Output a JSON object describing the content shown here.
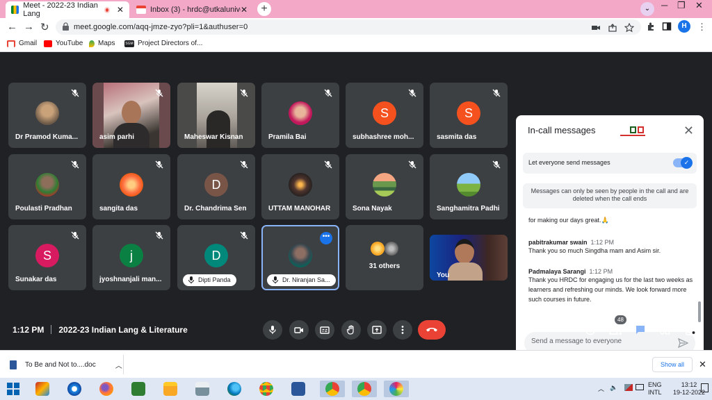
{
  "browser": {
    "tabs": [
      {
        "title": "Meet - 2022-23 Indian Lang",
        "active": true
      },
      {
        "title": "Inbox (3) - hrdc@utkaluniversity",
        "active": false
      }
    ],
    "new_tab": "+",
    "url": "meet.google.com/aqq-jmze-zyo?pli=1&authuser=0",
    "profile_initial": "H",
    "bookmarks": [
      "Gmail",
      "YouTube",
      "Maps",
      "Project Directors of..."
    ],
    "bookmark_ids": {
      "sgm": "SGM"
    }
  },
  "meet": {
    "tiles": [
      {
        "name": "Dr Pramod Kuma..."
      },
      {
        "name": "asim parhi"
      },
      {
        "name": "Maheswar Kisnan"
      },
      {
        "name": "Pramila Bai"
      },
      {
        "name": "subhashree moh...",
        "initial": "S"
      },
      {
        "name": "sasmita das",
        "initial": "S"
      },
      {
        "name": "Poulasti Pradhan"
      },
      {
        "name": "sangita das"
      },
      {
        "name": "Dr. Chandrima Sen",
        "initial": "D"
      },
      {
        "name": "UTTAM MANOHAR"
      },
      {
        "name": "Sona Nayak"
      },
      {
        "name": "Sanghamitra Padhi"
      },
      {
        "name": "Sunakar das",
        "initial": "S"
      },
      {
        "name": "jyoshnanjali man...",
        "initial": "j"
      },
      {
        "name": "Dipti Panda",
        "initial": "D"
      },
      {
        "name": "Dr. Niranjan Sa..."
      },
      {
        "name": "31 others"
      },
      {
        "name": "You"
      }
    ],
    "time": "1:12 PM",
    "meeting_title": "2022-23 Indian Lang & Literature",
    "participants_count": "48",
    "more_options": "•••"
  },
  "panel": {
    "title": "In-call messages",
    "close": "✕",
    "toggle_label": "Let everyone send messages",
    "notice": "Messages can only be seen by people in the call and are deleted when the call ends",
    "messages": [
      {
        "author": "",
        "time": "",
        "text": "for making our days great.🙏"
      },
      {
        "author": "pabitrakumar swain",
        "time": "1:12 PM",
        "text": "Thank you so much Singdha mam and Asim sir."
      },
      {
        "author": "Padmalaya Sarangi",
        "time": "1:12 PM",
        "text": "Thank you  HRDC for engaging us for  the last  two weeks as learners and refreshing our minds. We look forward more such courses in future."
      }
    ],
    "compose_placeholder": "Send a message to everyone"
  },
  "downloads": {
    "file": "To Be and Not to....doc",
    "show_all": "Show all",
    "close": "✕"
  },
  "taskbar": {
    "lang1": "ENG",
    "lang2": "INTL",
    "time": "13:12",
    "date": "19-12-2022"
  },
  "colors": {
    "meet_bg": "#202124",
    "tile_bg": "#3c4043",
    "end_call": "#ea4335",
    "accent": "#1a73e8",
    "avatar_s": "#f4511e",
    "avatar_d_brown": "#795548",
    "avatar_d_teal": "#00897b",
    "avatar_j": "#0b8043",
    "avatar_s2": "#d81b60"
  }
}
